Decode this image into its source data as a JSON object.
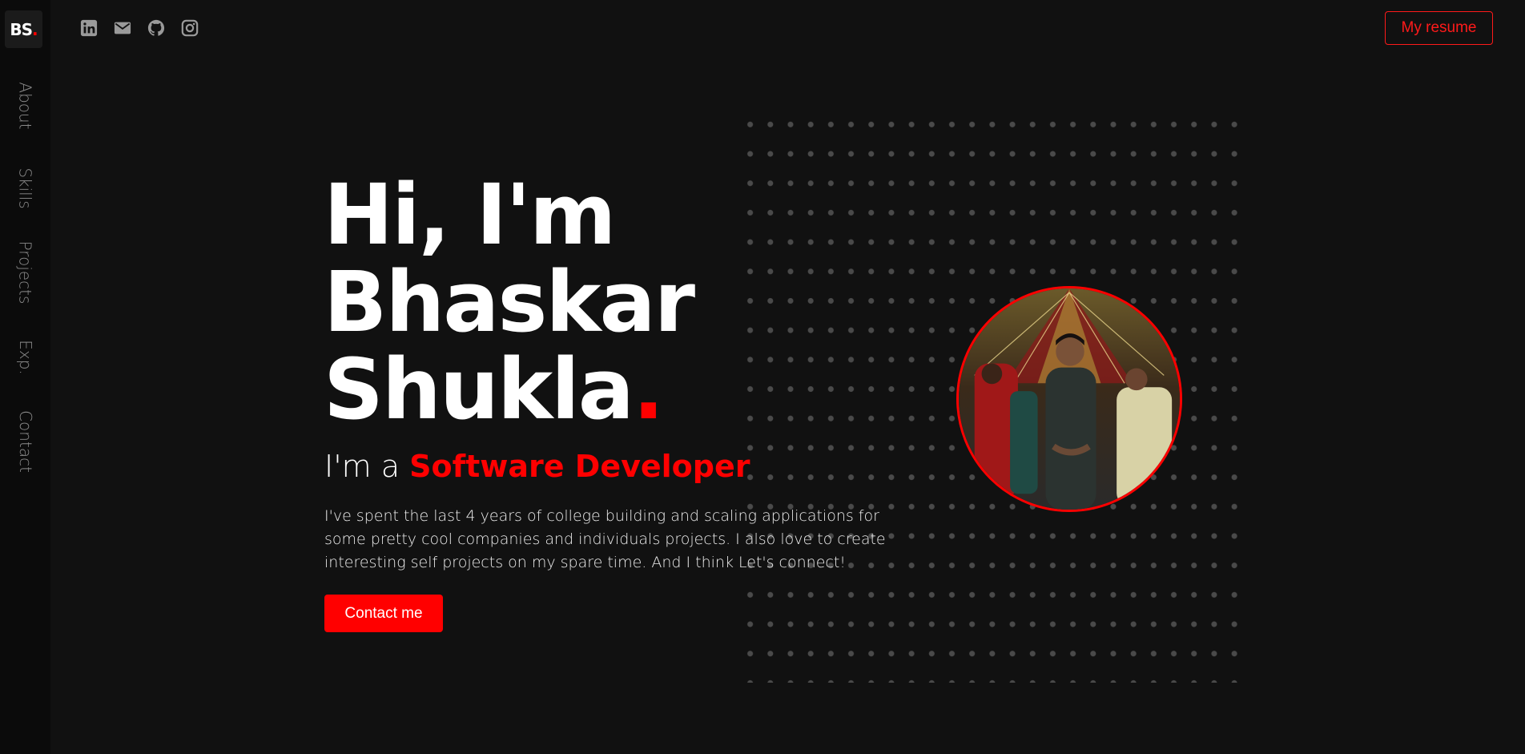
{
  "logo": {
    "text": "BS",
    "dot": "."
  },
  "sidebar": {
    "items": [
      {
        "label": "About"
      },
      {
        "label": "Skills"
      },
      {
        "label": "Projects"
      },
      {
        "label": "Exp."
      },
      {
        "label": "Contact"
      }
    ]
  },
  "socials": [
    {
      "name": "linkedin-icon"
    },
    {
      "name": "mail-icon"
    },
    {
      "name": "github-icon"
    },
    {
      "name": "instagram-icon"
    }
  ],
  "header": {
    "resume_label": "My resume"
  },
  "hero": {
    "line1": "Hi, I'm",
    "line2": "Bhaskar",
    "line3": "Shukla",
    "dot": ".",
    "subtitle_prefix": "I'm a ",
    "subtitle_role": "Software Developer",
    "description": "I've spent the last 4 years of college building and scaling applications for some pretty cool companies and individuals projects. I also love to create interesting self projects on my spare time. And I think Let's connect!",
    "contact_label": "Contact me"
  },
  "colors": {
    "background": "#111111",
    "sidebar": "#0b0b0b",
    "accent": "#ff0000",
    "text": "#ffffff",
    "muted": "#8b8b8b"
  }
}
